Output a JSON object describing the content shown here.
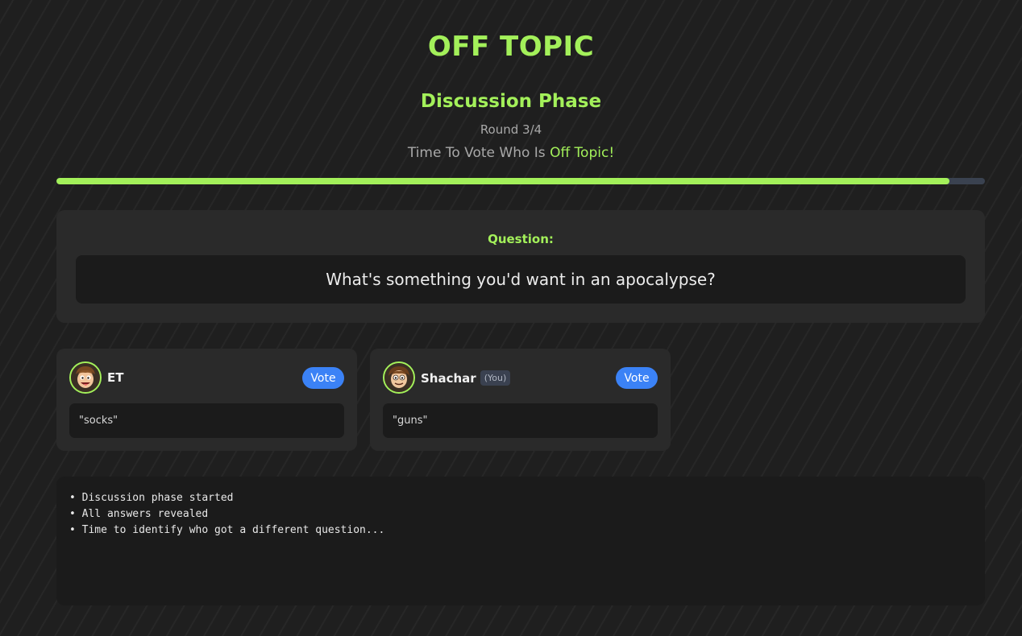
{
  "header": {
    "title": "OFF TOPIC",
    "phase": "Discussion Phase",
    "round": "Round 3/4",
    "status_prefix": "Time To Vote Who Is ",
    "status_highlight": "Off Topic!"
  },
  "timer": {
    "progress_fraction": 0.962
  },
  "question": {
    "label": "Question:",
    "text": "What's something you'd want in an apocalypse?"
  },
  "players": [
    {
      "name": "ET",
      "avatar_icon": "cartoon-face-avatar",
      "is_you": false,
      "you_label": "",
      "vote_label": "Vote",
      "answer": "\"socks\""
    },
    {
      "name": "Shachar",
      "avatar_icon": "cartoon-face-avatar",
      "is_you": true,
      "you_label": "(You)",
      "vote_label": "Vote",
      "answer": "\"guns\""
    }
  ],
  "log": {
    "lines": [
      "• Discussion phase started",
      "• All answers revealed",
      "• Time to identify who got a different question..."
    ]
  },
  "colors": {
    "accent": "#a3f05a",
    "vote_button": "#3b82f6",
    "background": "#1f1f1f",
    "card": "#2a2a2a",
    "inner_box": "#1b1b1b"
  }
}
